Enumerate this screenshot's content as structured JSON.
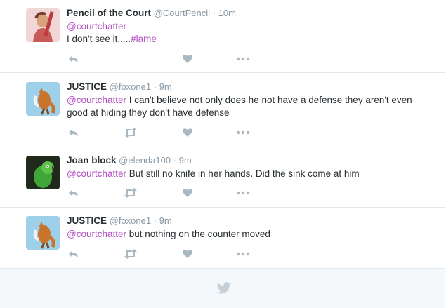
{
  "icons": {
    "reply": "reply-icon",
    "retweet": "retweet-icon",
    "like": "heart-icon",
    "more": "more-dots-icon",
    "footer": "twitter-bird-icon"
  },
  "colors": {
    "accent_link": "#b34fc3",
    "muted": "#8899a6",
    "icon": "#aab8c2",
    "divider": "#e1e8ed",
    "footer_bg": "#f5f8fa"
  },
  "tweets": [
    {
      "name": "Pencil of the Court",
      "handle": "@CourtPencil",
      "separator": "·",
      "time": "10m",
      "mention": "@courtchatter",
      "text": "I don't see it.....",
      "hashtag": "#lame",
      "avatar": "pencil-court-avatar",
      "has_retweet": false
    },
    {
      "name": "JUSTICE",
      "handle": "@foxone1",
      "separator": "·",
      "time": "9m",
      "mention": "@courtchatter",
      "text": " I can't believe not only does he not have a defense they aren't even good at hiding they don't have defense",
      "avatar": "fox-avatar",
      "has_retweet": true
    },
    {
      "name": "Joan block",
      "handle": "@elenda100",
      "separator": "·",
      "time": "9m",
      "mention": "@courtchatter",
      "text": " But still no knife in her hands.  Did the sink come at him",
      "avatar": "parrot-avatar",
      "has_retweet": true
    },
    {
      "name": "JUSTICE",
      "handle": "@foxone1",
      "separator": "·",
      "time": "9m",
      "mention": "@courtchatter",
      "text": " but nothing on the counter moved",
      "avatar": "fox-avatar",
      "has_retweet": true
    }
  ]
}
